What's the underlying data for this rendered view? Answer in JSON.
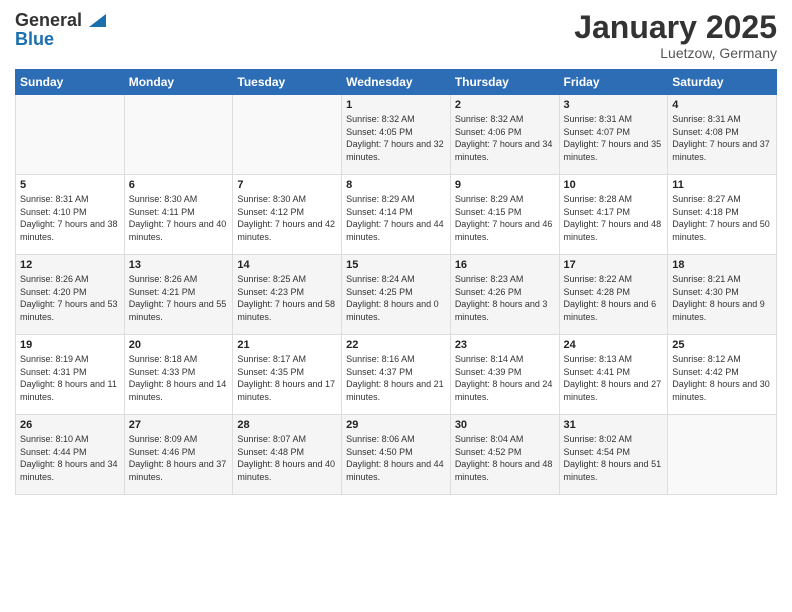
{
  "header": {
    "logo_line1": "General",
    "logo_line2": "Blue",
    "calendar_title": "January 2025",
    "calendar_subtitle": "Luetzow, Germany"
  },
  "days_of_week": [
    "Sunday",
    "Monday",
    "Tuesday",
    "Wednesday",
    "Thursday",
    "Friday",
    "Saturday"
  ],
  "weeks": [
    [
      {
        "day": "",
        "sunrise": "",
        "sunset": "",
        "daylight": ""
      },
      {
        "day": "",
        "sunrise": "",
        "sunset": "",
        "daylight": ""
      },
      {
        "day": "",
        "sunrise": "",
        "sunset": "",
        "daylight": ""
      },
      {
        "day": "1",
        "sunrise": "Sunrise: 8:32 AM",
        "sunset": "Sunset: 4:05 PM",
        "daylight": "Daylight: 7 hours and 32 minutes."
      },
      {
        "day": "2",
        "sunrise": "Sunrise: 8:32 AM",
        "sunset": "Sunset: 4:06 PM",
        "daylight": "Daylight: 7 hours and 34 minutes."
      },
      {
        "day": "3",
        "sunrise": "Sunrise: 8:31 AM",
        "sunset": "Sunset: 4:07 PM",
        "daylight": "Daylight: 7 hours and 35 minutes."
      },
      {
        "day": "4",
        "sunrise": "Sunrise: 8:31 AM",
        "sunset": "Sunset: 4:08 PM",
        "daylight": "Daylight: 7 hours and 37 minutes."
      }
    ],
    [
      {
        "day": "5",
        "sunrise": "Sunrise: 8:31 AM",
        "sunset": "Sunset: 4:10 PM",
        "daylight": "Daylight: 7 hours and 38 minutes."
      },
      {
        "day": "6",
        "sunrise": "Sunrise: 8:30 AM",
        "sunset": "Sunset: 4:11 PM",
        "daylight": "Daylight: 7 hours and 40 minutes."
      },
      {
        "day": "7",
        "sunrise": "Sunrise: 8:30 AM",
        "sunset": "Sunset: 4:12 PM",
        "daylight": "Daylight: 7 hours and 42 minutes."
      },
      {
        "day": "8",
        "sunrise": "Sunrise: 8:29 AM",
        "sunset": "Sunset: 4:14 PM",
        "daylight": "Daylight: 7 hours and 44 minutes."
      },
      {
        "day": "9",
        "sunrise": "Sunrise: 8:29 AM",
        "sunset": "Sunset: 4:15 PM",
        "daylight": "Daylight: 7 hours and 46 minutes."
      },
      {
        "day": "10",
        "sunrise": "Sunrise: 8:28 AM",
        "sunset": "Sunset: 4:17 PM",
        "daylight": "Daylight: 7 hours and 48 minutes."
      },
      {
        "day": "11",
        "sunrise": "Sunrise: 8:27 AM",
        "sunset": "Sunset: 4:18 PM",
        "daylight": "Daylight: 7 hours and 50 minutes."
      }
    ],
    [
      {
        "day": "12",
        "sunrise": "Sunrise: 8:26 AM",
        "sunset": "Sunset: 4:20 PM",
        "daylight": "Daylight: 7 hours and 53 minutes."
      },
      {
        "day": "13",
        "sunrise": "Sunrise: 8:26 AM",
        "sunset": "Sunset: 4:21 PM",
        "daylight": "Daylight: 7 hours and 55 minutes."
      },
      {
        "day": "14",
        "sunrise": "Sunrise: 8:25 AM",
        "sunset": "Sunset: 4:23 PM",
        "daylight": "Daylight: 7 hours and 58 minutes."
      },
      {
        "day": "15",
        "sunrise": "Sunrise: 8:24 AM",
        "sunset": "Sunset: 4:25 PM",
        "daylight": "Daylight: 8 hours and 0 minutes."
      },
      {
        "day": "16",
        "sunrise": "Sunrise: 8:23 AM",
        "sunset": "Sunset: 4:26 PM",
        "daylight": "Daylight: 8 hours and 3 minutes."
      },
      {
        "day": "17",
        "sunrise": "Sunrise: 8:22 AM",
        "sunset": "Sunset: 4:28 PM",
        "daylight": "Daylight: 8 hours and 6 minutes."
      },
      {
        "day": "18",
        "sunrise": "Sunrise: 8:21 AM",
        "sunset": "Sunset: 4:30 PM",
        "daylight": "Daylight: 8 hours and 9 minutes."
      }
    ],
    [
      {
        "day": "19",
        "sunrise": "Sunrise: 8:19 AM",
        "sunset": "Sunset: 4:31 PM",
        "daylight": "Daylight: 8 hours and 11 minutes."
      },
      {
        "day": "20",
        "sunrise": "Sunrise: 8:18 AM",
        "sunset": "Sunset: 4:33 PM",
        "daylight": "Daylight: 8 hours and 14 minutes."
      },
      {
        "day": "21",
        "sunrise": "Sunrise: 8:17 AM",
        "sunset": "Sunset: 4:35 PM",
        "daylight": "Daylight: 8 hours and 17 minutes."
      },
      {
        "day": "22",
        "sunrise": "Sunrise: 8:16 AM",
        "sunset": "Sunset: 4:37 PM",
        "daylight": "Daylight: 8 hours and 21 minutes."
      },
      {
        "day": "23",
        "sunrise": "Sunrise: 8:14 AM",
        "sunset": "Sunset: 4:39 PM",
        "daylight": "Daylight: 8 hours and 24 minutes."
      },
      {
        "day": "24",
        "sunrise": "Sunrise: 8:13 AM",
        "sunset": "Sunset: 4:41 PM",
        "daylight": "Daylight: 8 hours and 27 minutes."
      },
      {
        "day": "25",
        "sunrise": "Sunrise: 8:12 AM",
        "sunset": "Sunset: 4:42 PM",
        "daylight": "Daylight: 8 hours and 30 minutes."
      }
    ],
    [
      {
        "day": "26",
        "sunrise": "Sunrise: 8:10 AM",
        "sunset": "Sunset: 4:44 PM",
        "daylight": "Daylight: 8 hours and 34 minutes."
      },
      {
        "day": "27",
        "sunrise": "Sunrise: 8:09 AM",
        "sunset": "Sunset: 4:46 PM",
        "daylight": "Daylight: 8 hours and 37 minutes."
      },
      {
        "day": "28",
        "sunrise": "Sunrise: 8:07 AM",
        "sunset": "Sunset: 4:48 PM",
        "daylight": "Daylight: 8 hours and 40 minutes."
      },
      {
        "day": "29",
        "sunrise": "Sunrise: 8:06 AM",
        "sunset": "Sunset: 4:50 PM",
        "daylight": "Daylight: 8 hours and 44 minutes."
      },
      {
        "day": "30",
        "sunrise": "Sunrise: 8:04 AM",
        "sunset": "Sunset: 4:52 PM",
        "daylight": "Daylight: 8 hours and 48 minutes."
      },
      {
        "day": "31",
        "sunrise": "Sunrise: 8:02 AM",
        "sunset": "Sunset: 4:54 PM",
        "daylight": "Daylight: 8 hours and 51 minutes."
      },
      {
        "day": "",
        "sunrise": "",
        "sunset": "",
        "daylight": ""
      }
    ]
  ]
}
